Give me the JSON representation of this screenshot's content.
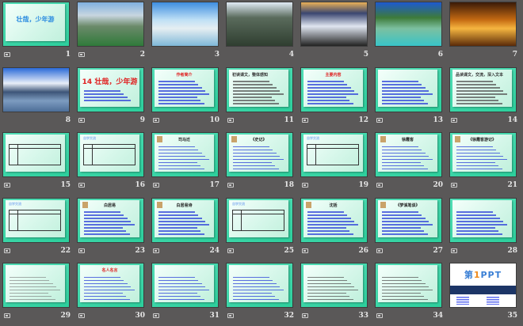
{
  "view": "slide-sorter",
  "colors": {
    "background": "#5a5858",
    "template_green": "#2ccf9c",
    "title_red": "#e02020",
    "body_blue": "#2b3fd8"
  },
  "slides": [
    {
      "number": "1",
      "kind": "title",
      "title": "壮哉，少年游",
      "has_icon": true
    },
    {
      "number": "2",
      "kind": "photo",
      "photo": "city",
      "has_icon": true
    },
    {
      "number": "3",
      "kind": "photo",
      "photo": "watertown",
      "has_icon": false
    },
    {
      "number": "4",
      "kind": "photo",
      "photo": "cliffs",
      "has_icon": false
    },
    {
      "number": "5",
      "kind": "photo",
      "photo": "sea-of-clouds",
      "has_icon": false
    },
    {
      "number": "6",
      "kind": "photo",
      "photo": "lake",
      "has_icon": false
    },
    {
      "number": "7",
      "kind": "photo",
      "photo": "sunset",
      "has_icon": false
    },
    {
      "number": "8",
      "kind": "photo",
      "photo": "bay",
      "has_icon": false
    },
    {
      "number": "9",
      "kind": "text",
      "title": "14 壮哉，少年游",
      "big": true,
      "has_icon": true
    },
    {
      "number": "10",
      "kind": "text",
      "title": "作者简介",
      "has_icon": true
    },
    {
      "number": "11",
      "kind": "text",
      "title": "初读课文，整体感知",
      "left": true,
      "dark": true,
      "has_icon": true
    },
    {
      "number": "12",
      "kind": "text",
      "title": "主要内容",
      "has_icon": true
    },
    {
      "number": "13",
      "kind": "text",
      "title": "",
      "has_icon": true
    },
    {
      "number": "14",
      "kind": "text",
      "title": "品读课文，交流，深入文本",
      "left": true,
      "dark": true,
      "has_icon": true
    },
    {
      "number": "15",
      "kind": "table",
      "title": "",
      "has_icon": true
    },
    {
      "number": "16",
      "kind": "table",
      "header": "自学交流",
      "has_icon": true
    },
    {
      "number": "17",
      "kind": "portrait",
      "title": "司马迁",
      "has_icon": true
    },
    {
      "number": "18",
      "kind": "portrait",
      "title": "《史记》",
      "has_icon": true
    },
    {
      "number": "19",
      "kind": "table",
      "header": "自学交流",
      "has_icon": true
    },
    {
      "number": "20",
      "kind": "portrait",
      "title": "徐霞客",
      "has_icon": true
    },
    {
      "number": "21",
      "kind": "portrait",
      "title": "《徐霞客游记》",
      "has_icon": true
    },
    {
      "number": "22",
      "kind": "table",
      "header": "自学交流",
      "has_icon": true
    },
    {
      "number": "23",
      "kind": "portrait",
      "title": "白居易",
      "has_icon": true
    },
    {
      "number": "24",
      "kind": "portrait",
      "title": "白居易诗",
      "has_icon": true
    },
    {
      "number": "25",
      "kind": "table",
      "header": "自学交流",
      "has_icon": true
    },
    {
      "number": "26",
      "kind": "portrait",
      "title": "沈括",
      "has_icon": true
    },
    {
      "number": "27",
      "kind": "portrait",
      "title": "《梦溪笔谈》",
      "has_icon": true
    },
    {
      "number": "28",
      "kind": "text",
      "title": "",
      "has_icon": true
    },
    {
      "number": "29",
      "kind": "text",
      "title": "",
      "gray": true,
      "has_icon": true
    },
    {
      "number": "30",
      "kind": "text",
      "title": "名人名言",
      "has_icon": true
    },
    {
      "number": "31",
      "kind": "text",
      "title": "",
      "has_icon": true
    },
    {
      "number": "32",
      "kind": "text",
      "title": "",
      "has_icon": true
    },
    {
      "number": "33",
      "kind": "text",
      "title": "",
      "dark": true,
      "has_icon": true
    },
    {
      "number": "34",
      "kind": "text",
      "title": "",
      "dark": true,
      "has_icon": true
    },
    {
      "number": "35",
      "kind": "ppt",
      "logo_pre": "第",
      "logo_num": "1",
      "logo_post": "PPT",
      "has_icon": false
    }
  ]
}
